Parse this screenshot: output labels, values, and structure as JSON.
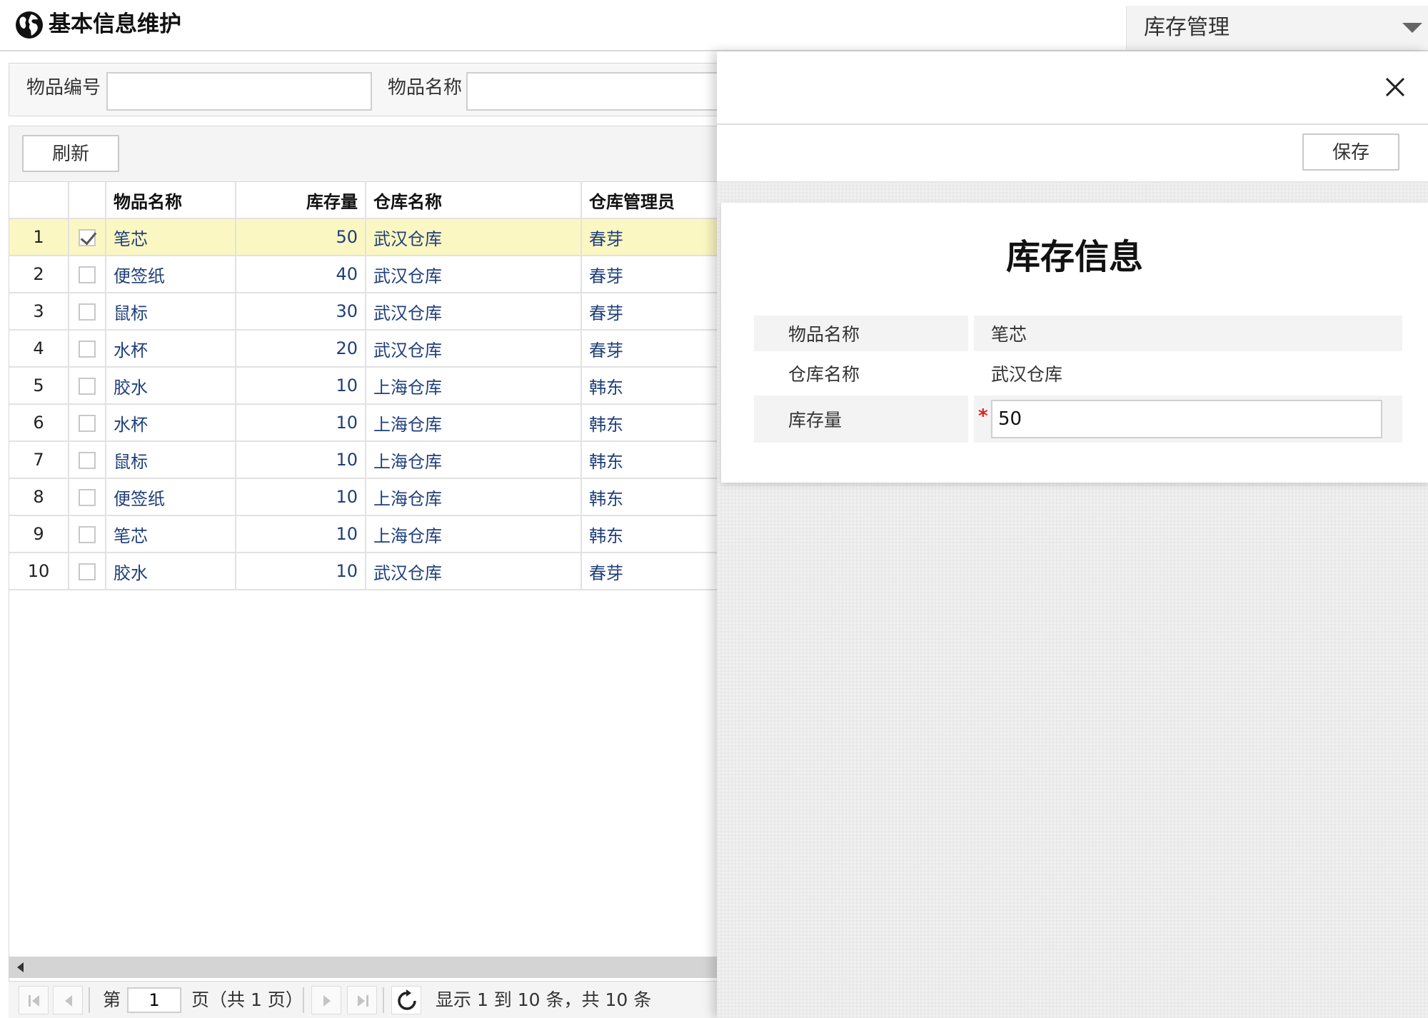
{
  "header": {
    "title": "基本信息维护",
    "module": "库存管理"
  },
  "search": {
    "item_code_label": "物品编号",
    "item_code_value": "",
    "item_name_label": "物品名称",
    "item_name_value": ""
  },
  "toolbar": {
    "refresh_label": "刷新"
  },
  "grid": {
    "columns": {
      "item_name": "物品名称",
      "quantity": "库存量",
      "warehouse": "仓库名称",
      "manager": "仓库管理员"
    },
    "rows": [
      {
        "no": "1",
        "checked": true,
        "item": "笔芯",
        "qty": "50",
        "warehouse": "武汉仓库",
        "manager": "春芽"
      },
      {
        "no": "2",
        "checked": false,
        "item": "便签纸",
        "qty": "40",
        "warehouse": "武汉仓库",
        "manager": "春芽"
      },
      {
        "no": "3",
        "checked": false,
        "item": "鼠标",
        "qty": "30",
        "warehouse": "武汉仓库",
        "manager": "春芽"
      },
      {
        "no": "4",
        "checked": false,
        "item": "水杯",
        "qty": "20",
        "warehouse": "武汉仓库",
        "manager": "春芽"
      },
      {
        "no": "5",
        "checked": false,
        "item": "胶水",
        "qty": "10",
        "warehouse": "上海仓库",
        "manager": "韩东"
      },
      {
        "no": "6",
        "checked": false,
        "item": "水杯",
        "qty": "10",
        "warehouse": "上海仓库",
        "manager": "韩东"
      },
      {
        "no": "7",
        "checked": false,
        "item": "鼠标",
        "qty": "10",
        "warehouse": "上海仓库",
        "manager": "韩东"
      },
      {
        "no": "8",
        "checked": false,
        "item": "便签纸",
        "qty": "10",
        "warehouse": "上海仓库",
        "manager": "韩东"
      },
      {
        "no": "9",
        "checked": false,
        "item": "笔芯",
        "qty": "10",
        "warehouse": "上海仓库",
        "manager": "韩东"
      },
      {
        "no": "10",
        "checked": false,
        "item": "胶水",
        "qty": "10",
        "warehouse": "武汉仓库",
        "manager": "春芽"
      }
    ]
  },
  "pager": {
    "prefix": "第",
    "page": "1",
    "suffix": "页（共 1 页）",
    "summary": "显示 1 到 10 条，共 10 条"
  },
  "drawer": {
    "save_label": "保存",
    "form_title": "库存信息",
    "fields": {
      "item_name_label": "物品名称",
      "item_name_value": "笔芯",
      "warehouse_label": "仓库名称",
      "warehouse_value": "武汉仓库",
      "quantity_label": "库存量",
      "quantity_value": "50",
      "required_mark": "*"
    }
  }
}
